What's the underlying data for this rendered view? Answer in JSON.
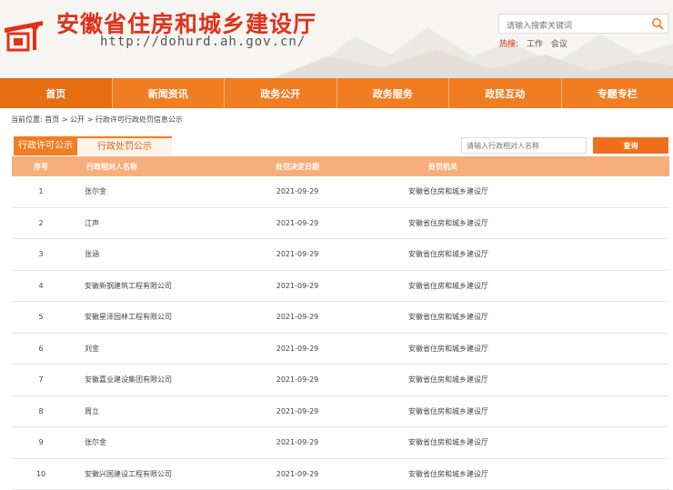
{
  "header": {
    "title": "安徽省住房和城乡建设厅",
    "url": "http://dohurd.ah.gov.cn/",
    "search_placeholder": "请输入搜索关键词",
    "hot_label": "热搜:",
    "hot_keywords": [
      "工作",
      "会议"
    ],
    "brand_color": "#e0321b"
  },
  "nav": {
    "items": [
      "首页",
      "新闻资讯",
      "政务公开",
      "政务服务",
      "政民互动",
      "专题专栏"
    ],
    "accent_color": "#f07d22"
  },
  "breadcrumb": "当前位置: 首页 > 公开 > 行政许可行政处罚信息公示",
  "tabs": [
    "行政许可公示",
    "行政处罚公示"
  ],
  "query": {
    "placeholder": "请输入行政相对人名称",
    "button_label": "查询"
  },
  "table": {
    "headers": [
      "序号",
      "行政相对人名称",
      "处罚决定日期",
      "处罚机关"
    ],
    "rows": [
      [
        "1",
        "张尔金",
        "2021-09-29",
        "安徽省住房和城乡建设厅"
      ],
      [
        "2",
        "江声",
        "2021-09-29",
        "安徽省住房和城乡建设厅"
      ],
      [
        "3",
        "张涵",
        "2021-09-29",
        "安徽省住房和城乡建设厅"
      ],
      [
        "4",
        "安徽新钢建筑工程有限公司",
        "2021-09-29",
        "安徽省住房和城乡建设厅"
      ],
      [
        "5",
        "安徽星泽园林工程有限公司",
        "2021-09-29",
        "安徽省住房和城乡建设厅"
      ],
      [
        "6",
        "刘金",
        "2021-09-29",
        "安徽省住房和城乡建设厅"
      ],
      [
        "7",
        "安徽嘉业建设集团有限公司",
        "2021-09-29",
        "安徽省住房和城乡建设厅"
      ],
      [
        "8",
        "周立",
        "2021-09-29",
        "安徽省住房和城乡建设厅"
      ],
      [
        "9",
        "张尔金",
        "2021-09-29",
        "安徽省住房和城乡建设厅"
      ],
      [
        "10",
        "安徽兴国建设工程有限公司",
        "2021-09-29",
        "安徽省住房和城乡建设厅"
      ]
    ]
  }
}
